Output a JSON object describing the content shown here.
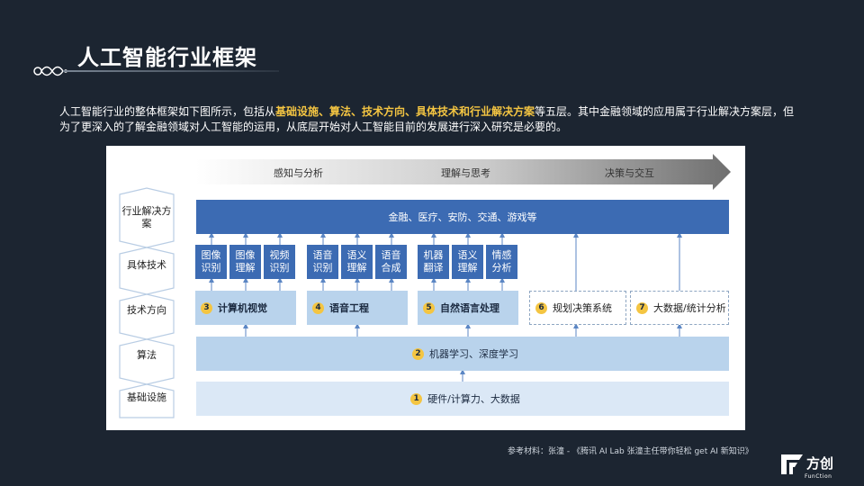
{
  "title": "人工智能行业框架",
  "intro": {
    "p1": "人工智能行业的整体框架如下图所示，包括从",
    "highlight": "基础设施、算法、技术方向、具体技术和行业解决方案",
    "p2": "等五层。其中金融领域的应用属于行业解决方案层，但为了更深入的了解金融领域对人工智能的运用，从底层开始对人工智能目前的发展进行深入研究是必要的。"
  },
  "diagram": {
    "stages": [
      "感知与分析",
      "理解与思考",
      "决策与交互"
    ],
    "layers": [
      "行业解决方案",
      "具体技术",
      "技术方向",
      "算法",
      "基础设施"
    ],
    "top_bar": "金融、医疗、安防、交通、游戏等",
    "cells": [
      [
        "图像",
        "识别"
      ],
      [
        "图像",
        "理解"
      ],
      [
        "视频",
        "识别"
      ],
      [
        "语音",
        "识别"
      ],
      [
        "语义",
        "理解"
      ],
      [
        "语音",
        "合成"
      ],
      [
        "机器",
        "翻译"
      ],
      [
        "语义",
        "理解"
      ],
      [
        "情感",
        "分析"
      ]
    ],
    "tech": [
      {
        "num": "3",
        "label": "计算机视觉"
      },
      {
        "num": "4",
        "label": "语音工程"
      },
      {
        "num": "5",
        "label": "自然语言处理"
      },
      {
        "num": "6",
        "label": "规划决策系统"
      },
      {
        "num": "7",
        "label": "大数据/统计分析"
      }
    ],
    "algo": {
      "num": "2",
      "label": "机器学习、深度学习"
    },
    "base": {
      "num": "1",
      "label": "硬件/计算力、大数据"
    }
  },
  "footer": "参考材料：张潼 - 《腾讯 AI Lab 张潼主任带你轻松 get AI 新知识》",
  "logo": {
    "text": "方创",
    "sub": "FunCtion"
  }
}
